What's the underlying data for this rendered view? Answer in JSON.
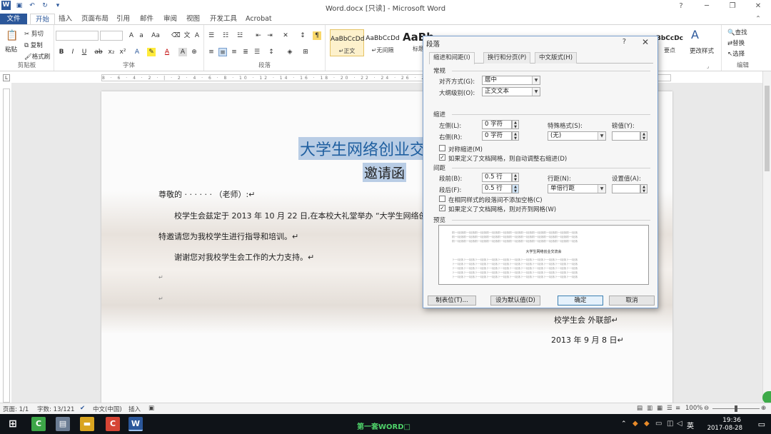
{
  "titlebar": {
    "title": "Word.docx [只读] - Microsoft Word",
    "minimize": "─",
    "restore": "❐",
    "close": "✕",
    "qat": [
      "save-icon",
      "undo-icon",
      "redo-icon",
      "customize-icon"
    ]
  },
  "tabs": [
    "文件",
    "开始",
    "插入",
    "页面布局",
    "引用",
    "邮件",
    "审阅",
    "视图",
    "开发工具",
    "Acrobat"
  ],
  "ribbon": {
    "clipboard": {
      "paste": "粘贴",
      "cut": "剪切",
      "copy": "复制",
      "format_painter": "格式刷",
      "label": "剪贴板"
    },
    "font": {
      "label": "字体"
    },
    "paragraph": {
      "label": "段落"
    },
    "styles": [
      {
        "sample": "AaBbCcDd",
        "name": "↵正文"
      },
      {
        "sample": "AaBbCcDd",
        "name": "↵无间隔"
      },
      {
        "sample": "AaBb",
        "name": "标题"
      }
    ],
    "styles_extra": {
      "sample": "BbCcDc",
      "name": "要点"
    },
    "change_styles": "更改样式",
    "editing": {
      "find": "查找",
      "replace": "替换",
      "select": "选择",
      "label": "编辑"
    },
    "accent": "#2b579a"
  },
  "document": {
    "heading1": "大学生网络创业交",
    "heading2": "邀请函",
    "greeting": "尊敬的 · · · · · · （老师）:↵",
    "para1": "校学生会兹定于 2013 年 10 月 22 日,在本校大礼堂举办 “大学生网络创",
    "para2": "特邀请您为我校学生进行指导和培训。↵",
    "para3": "谢谢您对我校学生会工作的大力支持。↵",
    "mark": "↵",
    "sign1": "校学生会 外联部↵",
    "sign2": "2013 年 9 月 8 日↵"
  },
  "statusbar": {
    "page": "页面: 1/1",
    "words": "字数: 13/121",
    "lang": "中文(中国)",
    "mode": "插入",
    "zoom": "100%"
  },
  "taskbar": {
    "caption": "第一套WORD□",
    "time": "19:36",
    "date": "2017-08-28",
    "ime": "英"
  },
  "dialog": {
    "title": "段落",
    "help": "?",
    "close": "✕",
    "tabs": [
      "缩进和间距(I)",
      "换行和分页(P)",
      "中文版式(H)"
    ],
    "general": {
      "section": "常规",
      "align_label": "对齐方式(G):",
      "align_value": "居中",
      "outline_label": "大纲级别(O):",
      "outline_value": "正文文本"
    },
    "indent": {
      "section": "缩进",
      "left_label": "左侧(L):",
      "left_value": "0 字符",
      "right_label": "右侧(R):",
      "right_value": "0 字符",
      "special_label": "特殊格式(S):",
      "special_value": "(无)",
      "by_label": "磅值(Y):",
      "by_value": "",
      "mirror": "对称缩进(M)",
      "auto_adjust": "如果定义了文档网格，则自动调整右缩进(D)",
      "mirror_checked": false,
      "auto_adjust_checked": true
    },
    "spacing": {
      "section": "间距",
      "before_label": "段前(B):",
      "before_value": "0.5 行",
      "after_label": "段后(F):",
      "after_value": "0.5 行",
      "line_label": "行距(N):",
      "line_value": "单倍行距",
      "at_label": "设置值(A):",
      "at_value": "",
      "no_space": "在相同样式的段落间不添加空格(C)",
      "snap_grid": "如果定义了文档网格，则对齐到网格(W)",
      "no_space_checked": false,
      "snap_grid_checked": true
    },
    "preview": {
      "section": "预览",
      "prev_text": "前一段落前一段落前一段落前一段落前一段落前一段落前一段落前一段落前一段落前一段落前一段落",
      "sample": "大学生网络创业交流会",
      "next_text": "下一段落下一段落下一段落下一段落下一段落下一段落下一段落下一段落下一段落下一段落下一段落"
    },
    "buttons": {
      "tabs": "制表位(T)...",
      "default": "设为默认值(D)",
      "ok": "确定",
      "cancel": "取消"
    }
  }
}
